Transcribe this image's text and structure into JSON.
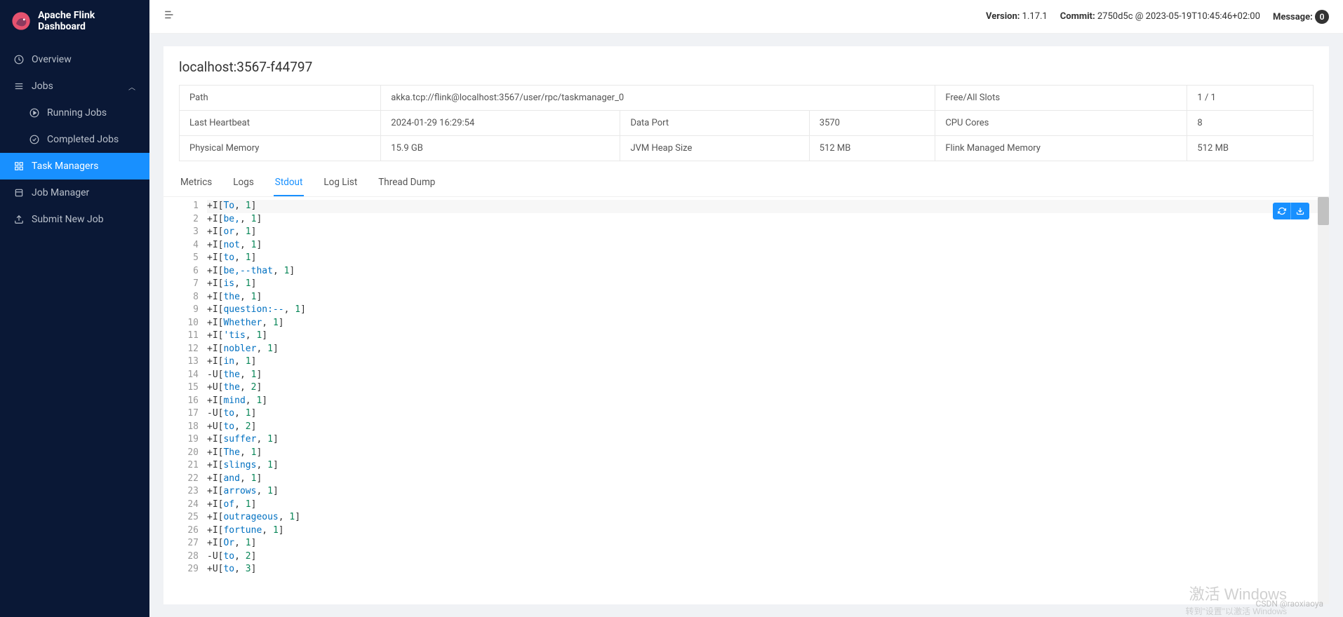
{
  "sidebar": {
    "title": "Apache Flink Dashboard",
    "items": [
      {
        "label": "Overview",
        "icon": "dashboard-icon"
      },
      {
        "label": "Jobs",
        "icon": "bars-icon",
        "expanded": true
      },
      {
        "label": "Running Jobs",
        "icon": "play-icon",
        "sub": true
      },
      {
        "label": "Completed Jobs",
        "icon": "check-icon",
        "sub": true
      },
      {
        "label": "Task Managers",
        "icon": "grid-icon",
        "active": true
      },
      {
        "label": "Job Manager",
        "icon": "build-icon"
      },
      {
        "label": "Submit New Job",
        "icon": "upload-icon"
      }
    ]
  },
  "topbar": {
    "version_label": "Version:",
    "version": "1.17.1",
    "commit_label": "Commit:",
    "commit": "2750d5c @ 2023-05-19T10:45:46+02:00",
    "message_label": "Message:",
    "message_count": "0"
  },
  "page": {
    "title": "localhost:3567-f44797",
    "info": {
      "path_label": "Path",
      "path": "akka.tcp://flink@localhost:3567/user/rpc/taskmanager_0",
      "free_slots_label": "Free/All Slots",
      "free_slots": "1 / 1",
      "last_heartbeat_label": "Last Heartbeat",
      "last_heartbeat": "2024-01-29 16:29:54",
      "data_port_label": "Data Port",
      "data_port": "3570",
      "cpu_cores_label": "CPU Cores",
      "cpu_cores": "8",
      "phys_mem_label": "Physical Memory",
      "phys_mem": "15.9 GB",
      "jvm_heap_label": "JVM Heap Size",
      "jvm_heap": "512 MB",
      "flink_mem_label": "Flink Managed Memory",
      "flink_mem": "512 MB"
    }
  },
  "tabs": [
    {
      "label": "Metrics"
    },
    {
      "label": "Logs"
    },
    {
      "label": "Stdout",
      "active": true
    },
    {
      "label": "Log List"
    },
    {
      "label": "Thread Dump"
    }
  ],
  "log_lines": [
    {
      "op": "+I",
      "key": "To",
      "num": "1"
    },
    {
      "op": "+I",
      "key": "be,",
      "num": "1"
    },
    {
      "op": "+I",
      "key": "or",
      "num": "1"
    },
    {
      "op": "+I",
      "key": "not",
      "num": "1"
    },
    {
      "op": "+I",
      "key": "to",
      "num": "1"
    },
    {
      "op": "+I",
      "key": "be,--that",
      "num": "1"
    },
    {
      "op": "+I",
      "key": "is",
      "num": "1"
    },
    {
      "op": "+I",
      "key": "the",
      "num": "1"
    },
    {
      "op": "+I",
      "key": "question:--",
      "num": "1"
    },
    {
      "op": "+I",
      "key": "Whether",
      "num": "1"
    },
    {
      "op": "+I",
      "key": "'tis",
      "num": "1"
    },
    {
      "op": "+I",
      "key": "nobler",
      "num": "1"
    },
    {
      "op": "+I",
      "key": "in",
      "num": "1"
    },
    {
      "op": "-U",
      "key": "the",
      "num": "1"
    },
    {
      "op": "+U",
      "key": "the",
      "num": "2"
    },
    {
      "op": "+I",
      "key": "mind",
      "num": "1"
    },
    {
      "op": "-U",
      "key": "to",
      "num": "1"
    },
    {
      "op": "+U",
      "key": "to",
      "num": "2"
    },
    {
      "op": "+I",
      "key": "suffer",
      "num": "1"
    },
    {
      "op": "+I",
      "key": "The",
      "num": "1"
    },
    {
      "op": "+I",
      "key": "slings",
      "num": "1"
    },
    {
      "op": "+I",
      "key": "and",
      "num": "1"
    },
    {
      "op": "+I",
      "key": "arrows",
      "num": "1"
    },
    {
      "op": "+I",
      "key": "of",
      "num": "1"
    },
    {
      "op": "+I",
      "key": "outrageous",
      "num": "1"
    },
    {
      "op": "+I",
      "key": "fortune",
      "num": "1"
    },
    {
      "op": "+I",
      "key": "Or",
      "num": "1"
    },
    {
      "op": "-U",
      "key": "to",
      "num": "2"
    },
    {
      "op": "+U",
      "key": "to",
      "num": "3"
    }
  ],
  "watermarks": {
    "line1": "激活 Windows",
    "line2": "转到\"设置\"以激活 Windows",
    "csdn": "CSDN @raoxiaoya"
  }
}
